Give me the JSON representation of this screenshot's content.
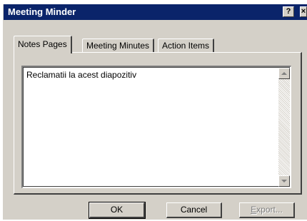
{
  "window": {
    "title": "Meeting Minder",
    "help_glyph": "?",
    "close_glyph": "×"
  },
  "tabs": [
    {
      "label": "Notes Pages",
      "active": true
    },
    {
      "label": "Meeting Minutes",
      "active": false
    },
    {
      "label": "Action Items",
      "active": false
    }
  ],
  "notes": {
    "value": "Reclamatii la acest diapozitiv"
  },
  "buttons": {
    "ok": "OK",
    "cancel": "Cancel",
    "export_accel": "E",
    "export_rest": "xport..."
  },
  "colors": {
    "titlebar": "#0a246a",
    "face": "#d4d0c8"
  }
}
